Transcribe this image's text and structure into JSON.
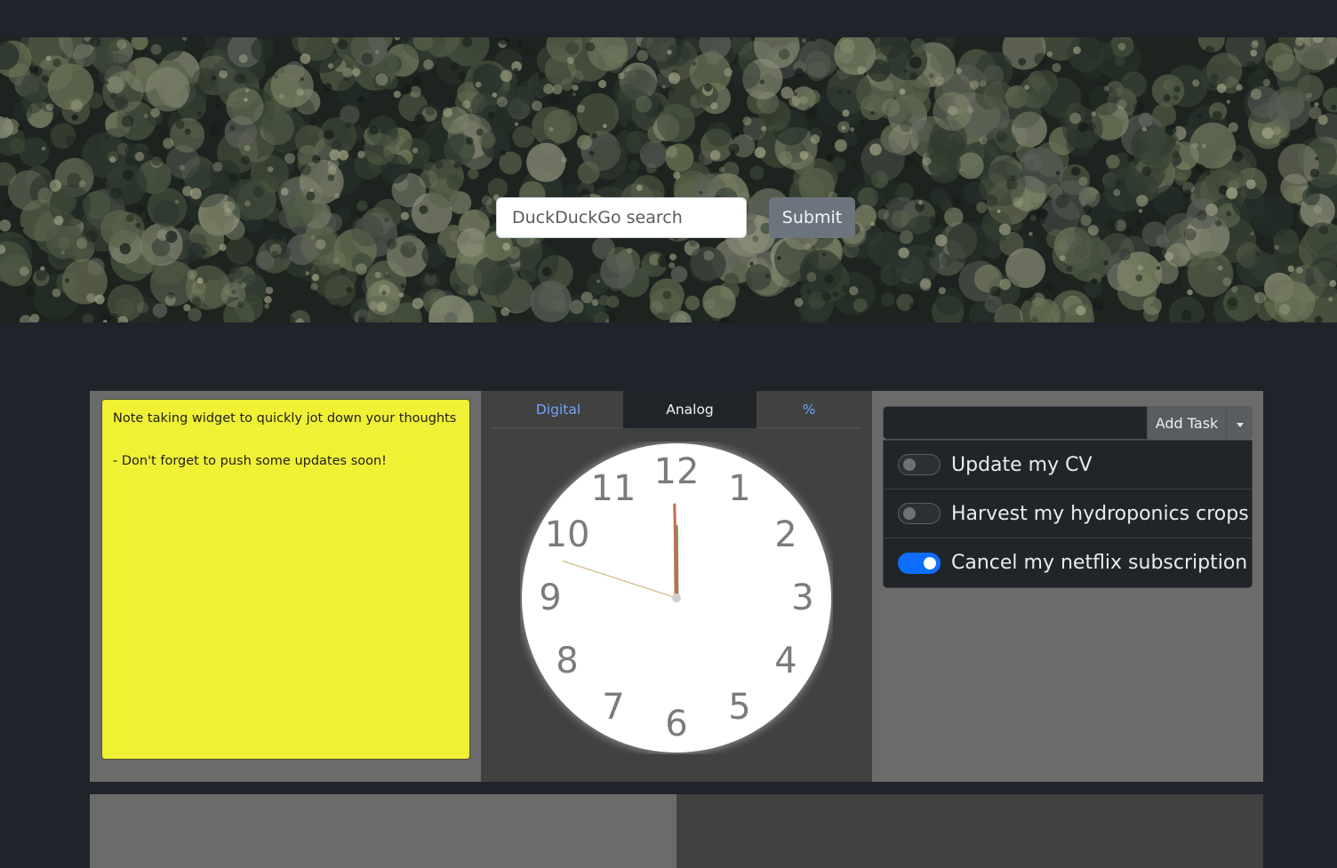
{
  "search": {
    "placeholder": "DuckDuckGo search",
    "submit_label": "Submit"
  },
  "note": {
    "text": "Note taking widget to quickly jot down your thoughts\n\n- Don't forget to push some updates soon!"
  },
  "clock": {
    "tabs": [
      {
        "label": "Digital",
        "active": false
      },
      {
        "label": "Analog",
        "active": true
      },
      {
        "label": "%",
        "active": false
      }
    ],
    "numerals": [
      "12",
      "1",
      "2",
      "3",
      "4",
      "5",
      "6",
      "7",
      "8",
      "9",
      "10",
      "11"
    ],
    "time": {
      "hour": 11,
      "minute": 59,
      "second": 48
    }
  },
  "tasks": {
    "add_label": "Add Task",
    "items": [
      {
        "label": "Update my CV",
        "done": false
      },
      {
        "label": "Harvest my hydroponics crops",
        "done": false
      },
      {
        "label": "Cancel my netflix subscription",
        "done": true
      }
    ]
  },
  "colors": {
    "background": "#202329",
    "note": "#f0f035",
    "accent": "#0d6efd",
    "hour_hand": "#7a9559",
    "minute_hand": "#c96a4d",
    "second_hand": "#d8c69a"
  }
}
